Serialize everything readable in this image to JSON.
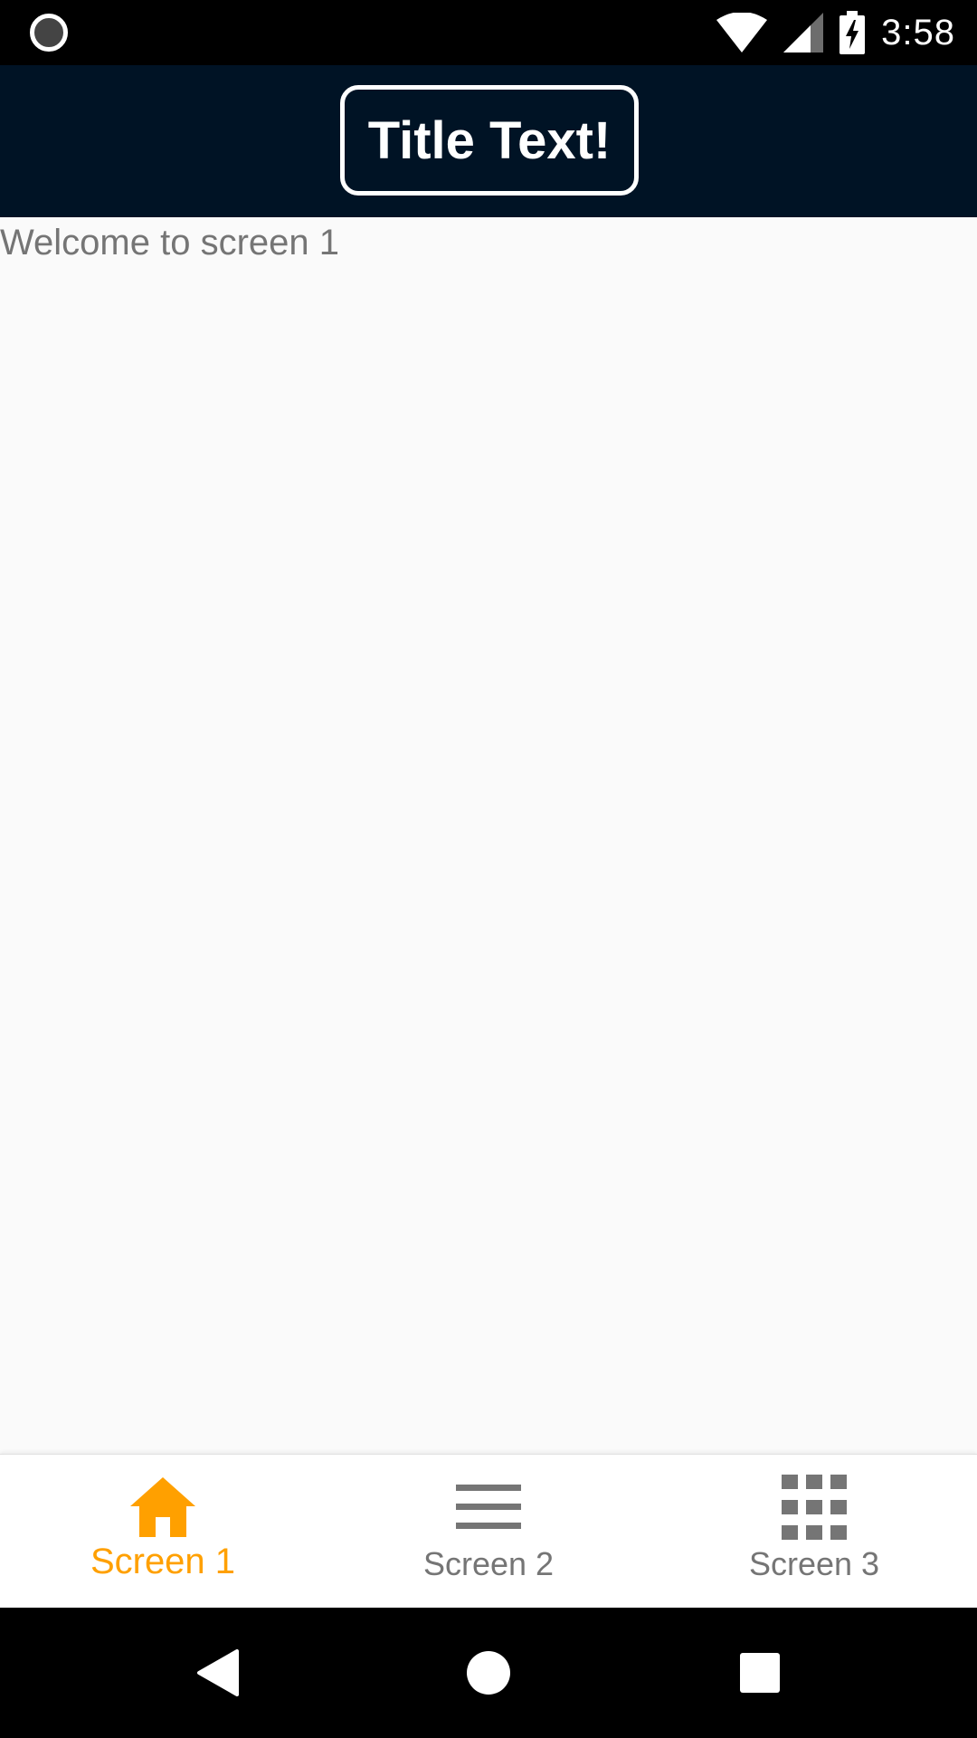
{
  "status_bar": {
    "time": "3:58",
    "icons": [
      "record-icon",
      "wifi-icon",
      "signal-icon",
      "battery-charging-icon"
    ]
  },
  "app_bar": {
    "title": "Title Text!",
    "background": "#001325"
  },
  "content": {
    "welcome_text": "Welcome to screen 1"
  },
  "bottom_nav": {
    "active_color": "#ffa000",
    "inactive_color": "#757575",
    "items": [
      {
        "label": "Screen 1",
        "icon": "home-icon",
        "active": true
      },
      {
        "label": "Screen 2",
        "icon": "menu-icon",
        "active": false
      },
      {
        "label": "Screen 3",
        "icon": "apps-grid-icon",
        "active": false
      }
    ]
  },
  "system_nav": {
    "buttons": [
      "back-icon",
      "home-circle-icon",
      "recents-icon"
    ]
  }
}
